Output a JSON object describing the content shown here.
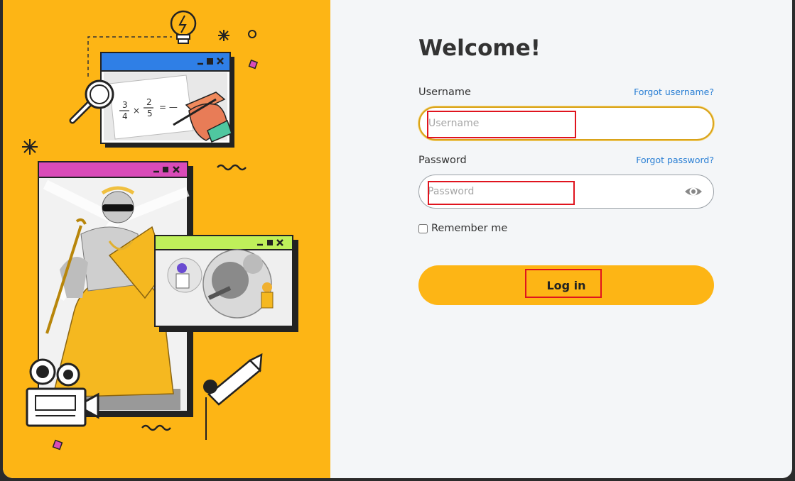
{
  "login": {
    "title": "Welcome!",
    "username_label": "Username",
    "username_placeholder": "Username",
    "username_value": "",
    "forgot_username": "Forgot username?",
    "password_label": "Password",
    "password_placeholder": "Password",
    "password_value": "",
    "forgot_password": "Forgot password?",
    "remember_label": "Remember me",
    "remember_checked": false,
    "login_button": "Log in",
    "show_password_icon": "eye-icon"
  },
  "illustration": {
    "math_card_text": "3/4 × 2/5 = —",
    "math_numerator_a": "3",
    "math_denominator_a": "4",
    "math_numerator_b": "2",
    "math_denominator_b": "5",
    "math_tail": "= —"
  },
  "colors": {
    "brand_yellow": "#fdb515",
    "link_blue": "#2a7fd4",
    "annotation_red": "#e0141e",
    "window_blue": "#2f7fe6",
    "window_magenta": "#d94bb8",
    "window_green": "#bff05a"
  }
}
